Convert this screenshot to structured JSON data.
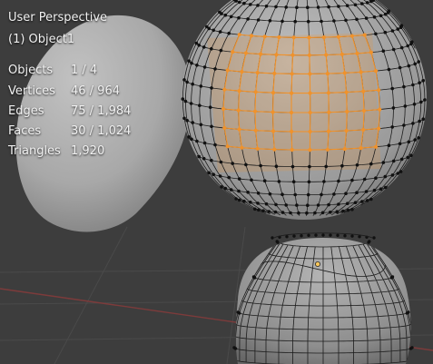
{
  "viewport": {
    "view_name": "User Perspective",
    "active_object": "(1) Object1"
  },
  "statistics": [
    {
      "label": "Objects",
      "value": "1 / 4"
    },
    {
      "label": "Vertices",
      "value": "46 / 964"
    },
    {
      "label": "Edges",
      "value": "75 / 1,984"
    },
    {
      "label": "Faces",
      "value": "30 / 1,024"
    },
    {
      "label": "Triangles",
      "value": "1,920"
    }
  ],
  "colors": {
    "background": "#3d3d3d",
    "mesh_surface": "#9a9a9a",
    "selection_orange": "#f0922b",
    "vertex_black": "#111111",
    "active_vertex": "#f7c65a"
  }
}
